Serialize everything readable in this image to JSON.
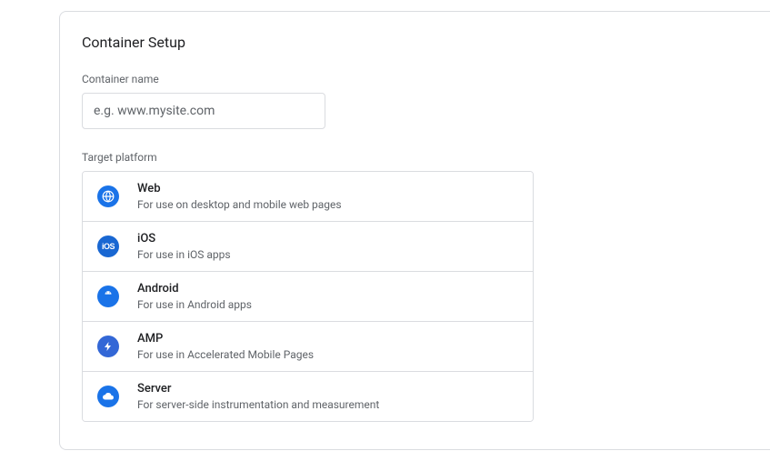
{
  "title": "Container Setup",
  "containerName": {
    "label": "Container name",
    "placeholder": "e.g. www.mysite.com",
    "value": ""
  },
  "targetPlatform": {
    "label": "Target platform",
    "options": [
      {
        "name": "Web",
        "desc": "For use on desktop and mobile web pages",
        "icon": "web"
      },
      {
        "name": "iOS",
        "desc": "For use in iOS apps",
        "icon": "ios"
      },
      {
        "name": "Android",
        "desc": "For use in Android apps",
        "icon": "android"
      },
      {
        "name": "AMP",
        "desc": "For use in Accelerated Mobile Pages",
        "icon": "amp"
      },
      {
        "name": "Server",
        "desc": "For server-side instrumentation and measurement",
        "icon": "server"
      }
    ]
  }
}
